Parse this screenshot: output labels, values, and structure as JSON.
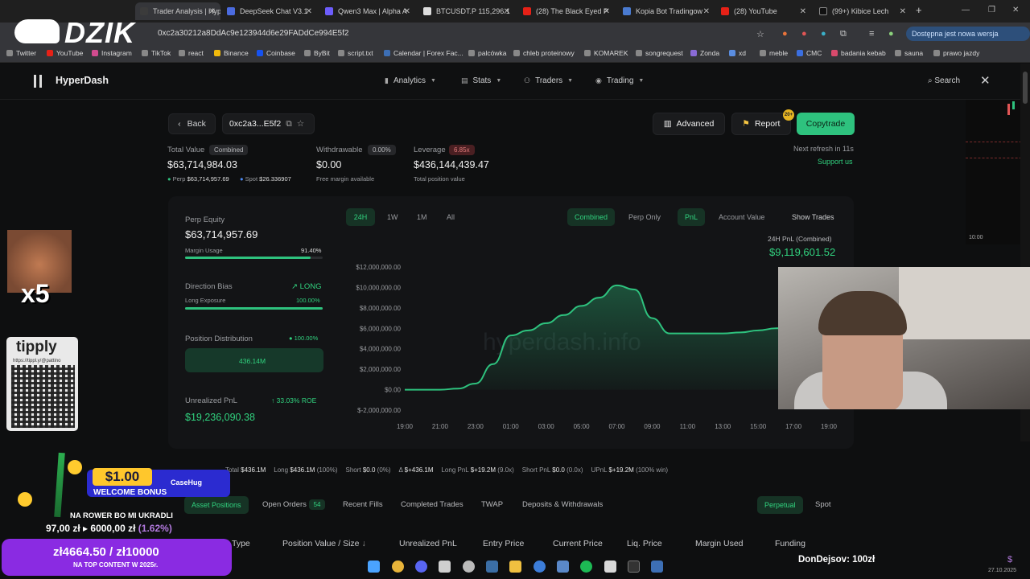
{
  "browser": {
    "tabs": [
      {
        "title": "Trader Analysis | Hyp",
        "color": "#3b3b3b",
        "active": true
      },
      {
        "title": "DeepSeek Chat V3.1",
        "color": "#4b6bdf"
      },
      {
        "title": "Qwen3 Max | Alpha A",
        "color": "#6d5dfc"
      },
      {
        "title": "BTCUSDT.P 115,296.1",
        "color": "#222222"
      },
      {
        "title": "(28) The Black Eyed P",
        "color": "#e62117"
      },
      {
        "title": "Kopia Bot Tradingow",
        "color": "#4a7bd0"
      },
      {
        "title": "(28) YouTube",
        "color": "#e62117"
      },
      {
        "title": "(99+) Kibice Lech",
        "color": "#111111"
      }
    ],
    "url": "0xc2a30212a8DdAc9e123944d6e29FADdCe994E5f2",
    "update_notice": "Dostępna jest nowa wersja Chrome",
    "bookmarks": [
      "Twitter",
      "YouTube",
      "Instagram",
      "TikTok",
      "react",
      "Binance",
      "Coinbase",
      "ByBit",
      "script.txt",
      "Calendar | Forex Fac...",
      "palcówka",
      "chleb proteinowy",
      "KOMAREK",
      "songrequest",
      "Zonda",
      "xd",
      "meble",
      "CMC",
      "badania kebab",
      "sauna",
      "prawo jazdy"
    ]
  },
  "app": {
    "brand": "HyperDash",
    "nav": [
      "Analytics",
      "Stats",
      "Traders",
      "Trading"
    ],
    "search_label": "Search"
  },
  "toolbar": {
    "back": "Back",
    "address": "0xc2a3...E5f2",
    "advanced": "Advanced",
    "report": "Report",
    "copytrade": "Copytrade",
    "report_badge": "20+"
  },
  "summary": {
    "total_value_label": "Total Value",
    "combined_pill": "Combined",
    "total_value": "$63,714,984.03",
    "perp_label": "Perp",
    "perp_value": "$63,714,957.69",
    "spot_label": "Spot",
    "spot_value": "$26.336907",
    "withdrawable_label": "Withdrawable",
    "withdrawable_pct": "0.00%",
    "withdrawable_value": "$0.00",
    "free_margin": "Free margin available",
    "leverage_label": "Leverage",
    "leverage_pill": "6.85x",
    "leverage_value": "$436,144,439.47",
    "position_value_label": "Total position value",
    "next_refresh": "Next refresh in 11s",
    "support": "Support us"
  },
  "left_panel": {
    "perp_equity_label": "Perp Equity",
    "perp_equity": "$63,714,957.69",
    "margin_usage_label": "Margin Usage",
    "margin_usage": "91.40%",
    "margin_usage_fraction": 0.914,
    "direction_bias_label": "Direction Bias",
    "direction_bias": "LONG",
    "long_exposure_label": "Long Exposure",
    "long_exposure": "100.00%",
    "long_exposure_fraction": 1.0,
    "position_distribution_label": "Position Distribution",
    "position_distribution_pct": "100.00%",
    "position_distribution_value": "436.14M",
    "unrealized_pnl_label": "Unrealized PnL",
    "roe": "33.03% ROE",
    "unrealized_pnl": "$19,236,090.38"
  },
  "chart_controls": {
    "ranges": [
      "24H",
      "1W",
      "1M",
      "All"
    ],
    "modes": [
      "Combined",
      "Perp Only"
    ],
    "metrics": [
      "PnL",
      "Account Value"
    ],
    "show_trades": "Show Trades",
    "watermark": "hyperdash.info"
  },
  "chart_data": {
    "type": "area",
    "title": "24H PnL (Combined)",
    "headline_value": "$9,119,601.52",
    "x_labels": [
      "19:00",
      "21:00",
      "23:00",
      "01:00",
      "03:00",
      "05:00",
      "07:00",
      "09:00",
      "11:00",
      "13:00",
      "15:00",
      "17:00",
      "19:00"
    ],
    "y_ticks": [
      "$12,000,000.00",
      "$10,000,000.00",
      "$8,000,000.00",
      "$6,000,000.00",
      "$4,000,000.00",
      "$2,000,000.00",
      "$0.00",
      "$-2,000,000.00"
    ],
    "ylim": [
      -2000000,
      12000000
    ],
    "x": [
      0,
      1,
      2,
      3,
      4,
      5,
      6,
      7,
      8,
      9,
      10,
      11,
      12,
      13,
      14,
      15,
      16,
      17,
      18,
      19,
      20,
      21,
      22,
      23,
      24
    ],
    "values": [
      0,
      0,
      0,
      100000,
      600000,
      2500000,
      5300000,
      5800000,
      6500000,
      7300000,
      8200000,
      9000000,
      10200000,
      9800000,
      7000000,
      5500000,
      5500000,
      5500000,
      5500000,
      5600000,
      5800000,
      6000000,
      6300000,
      6700000,
      7000000
    ]
  },
  "stats_row": {
    "total_label": "Total",
    "total": "$436.1M",
    "long_label": "Long",
    "long": "$436.1M",
    "long_pct": "(100%)",
    "short_label": "Short",
    "short": "$0.0",
    "short_pct": "(0%)",
    "delta": "$+436.1M",
    "long_pnl_label": "Long PnL",
    "long_pnl": "$+19.2M",
    "long_pnl_x": "(9.0x)",
    "short_pnl_label": "Short PnL",
    "short_pnl": "$0.0",
    "short_pnl_x": "(0.0x)",
    "upnl_label": "UPnL",
    "upnl": "$+19.2M",
    "upnl_win": "(100% win)"
  },
  "positions_tabs": {
    "items": [
      "Asset Positions",
      "Open Orders",
      "Recent Fills",
      "Completed Trades",
      "TWAP",
      "Deposits & Withdrawals"
    ],
    "open_orders_count": "54",
    "perpetual": "Perpetual",
    "spot": "Spot"
  },
  "table_headers": [
    "Type",
    "Position Value / Size",
    "Unrealized PnL",
    "Entry Price",
    "Current Price",
    "Liq. Price",
    "Margin Used",
    "Funding"
  ],
  "side_chart": {
    "time": "10:00"
  },
  "stream": {
    "logo": "DZIK",
    "multiplier": "x5",
    "tipply": "tipply",
    "tipply_url": "https://tippl.y/@pattino",
    "bonus_amount": "$1.00",
    "bonus_text": "WELCOME BONUS",
    "bonus_brand": "CaseHug",
    "goal_title": "NA ROWER BO MI UKRADLI",
    "goal_current": "97,00 zł",
    "goal_target": "6000,00 zł",
    "goal_pct": "(1.62%)",
    "goal2": "zł4664.50 / zł10000",
    "goal2_caption": "NA TOP CONTENT W 2025r.",
    "donation": "DonDejsov:  100zł",
    "date": "27.10.2025"
  }
}
